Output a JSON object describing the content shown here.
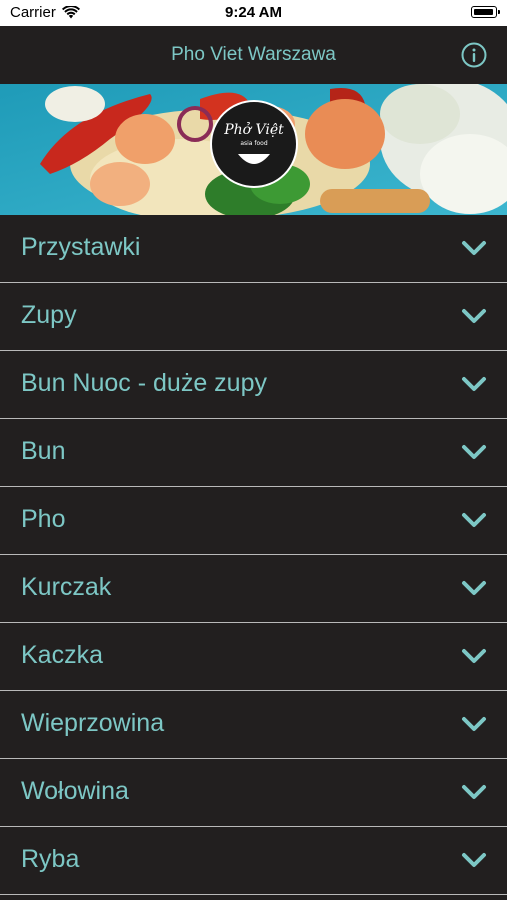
{
  "status_bar": {
    "carrier": "Carrier",
    "time": "9:24 AM"
  },
  "nav": {
    "title": "Pho Viet Warszawa",
    "info_icon": "info-icon"
  },
  "banner": {
    "logo_text": "Phở Việt",
    "logo_subtext": "asia food"
  },
  "menu": {
    "items": [
      {
        "label": "Przystawki"
      },
      {
        "label": "Zupy"
      },
      {
        "label": "Bun Nuoc - duże zupy"
      },
      {
        "label": "Bun"
      },
      {
        "label": "Pho"
      },
      {
        "label": "Kurczak"
      },
      {
        "label": "Kaczka"
      },
      {
        "label": "Wieprzowina"
      },
      {
        "label": "Wołowina"
      },
      {
        "label": "Ryba"
      }
    ]
  },
  "colors": {
    "accent": "#7dc7c5",
    "background": "#221f1f",
    "divider": "#b9b9b9"
  }
}
